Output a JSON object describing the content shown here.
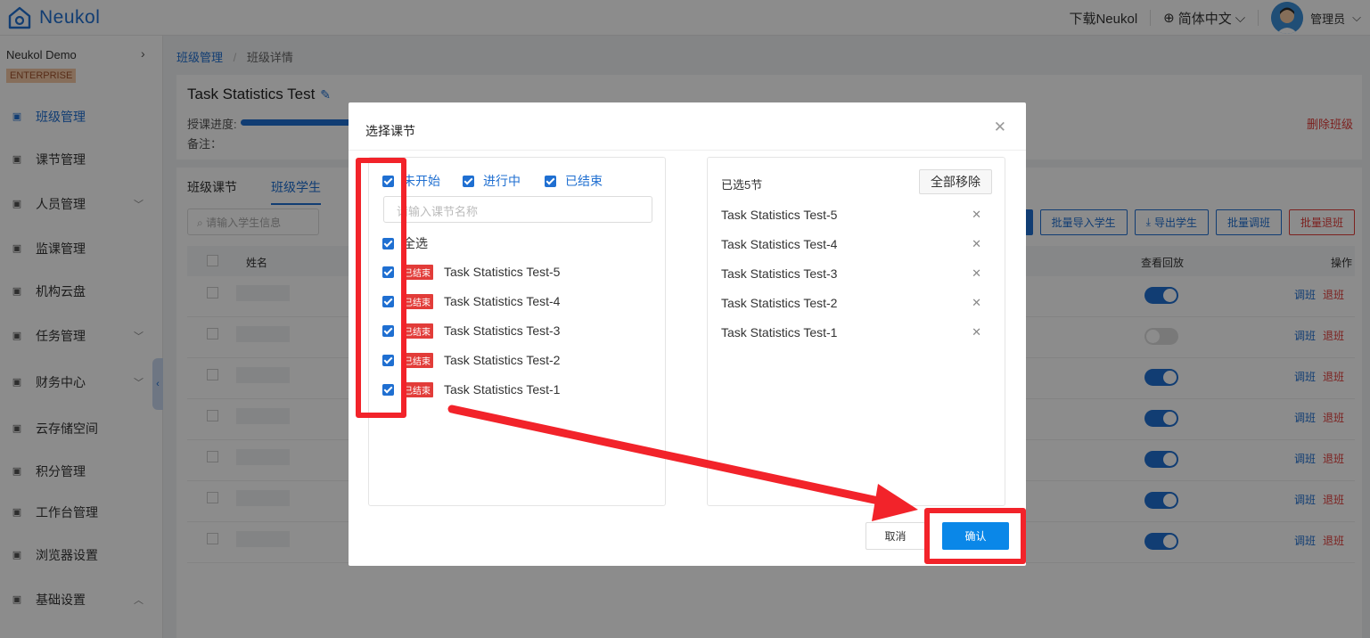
{
  "header": {
    "brand": "Neukol",
    "download": "下载Neukol",
    "language": "简体中文",
    "user": "管理员"
  },
  "sidebar": {
    "org_name": "Neukol Demo",
    "edition": "ENTERPRISE",
    "items": [
      {
        "label": "班级管理",
        "icon": "class-icon"
      },
      {
        "label": "课节管理",
        "icon": "lesson-icon"
      },
      {
        "label": "人员管理",
        "icon": "people-icon"
      },
      {
        "label": "监课管理",
        "icon": "monitor-icon"
      },
      {
        "label": "机构云盘",
        "icon": "cloud-icon"
      },
      {
        "label": "任务管理",
        "icon": "task-icon"
      },
      {
        "label": "财务中心",
        "icon": "finance-icon"
      },
      {
        "label": "云存储空间",
        "icon": "storage-icon"
      },
      {
        "label": "积分管理",
        "icon": "points-icon"
      },
      {
        "label": "工作台管理",
        "icon": "workbench-icon"
      },
      {
        "label": "浏览器设置",
        "icon": "browser-icon"
      },
      {
        "label": "基础设置",
        "icon": "settings-icon"
      }
    ]
  },
  "breadcrumb": {
    "level1": "班级管理",
    "sep": "/",
    "level2": "班级详情"
  },
  "class_info": {
    "title": "Task Statistics Test",
    "progress_label": "授课进度:",
    "note_label": "备注：",
    "delete_label": "删除班级"
  },
  "students": {
    "tabs": [
      "班级课节",
      "班级学生"
    ],
    "search_placeholder": "请输入学生信息",
    "buttons": [
      "批量导入学生",
      "导出学生",
      "批量调班",
      "批量退班"
    ],
    "columns": {
      "name": "姓名",
      "replay": "查看回放",
      "ops": "操作"
    },
    "row_op_transfer": "调班",
    "row_op_leave": "退班",
    "replay_toggles": [
      true,
      false,
      true,
      true,
      true,
      true,
      true
    ]
  },
  "modal": {
    "title": "选择课节",
    "filters": [
      "未开始",
      "进行中",
      "已结束"
    ],
    "search_placeholder": "请输入课节名称",
    "select_all": "全选",
    "status_tag": "已结束",
    "lessons": [
      "Task Statistics Test-5",
      "Task Statistics Test-4",
      "Task Statistics Test-3",
      "Task Statistics Test-2",
      "Task Statistics Test-1"
    ],
    "selected_header": "已选5节",
    "remove_all": "全部移除",
    "selected": [
      "Task Statistics Test-5",
      "Task Statistics Test-4",
      "Task Statistics Test-3",
      "Task Statistics Test-2",
      "Task Statistics Test-1"
    ],
    "cancel": "取消",
    "confirm": "确认"
  },
  "colors": {
    "primary": "#1f6fd1",
    "danger": "#e23c39",
    "annotation": "#f2232a"
  }
}
